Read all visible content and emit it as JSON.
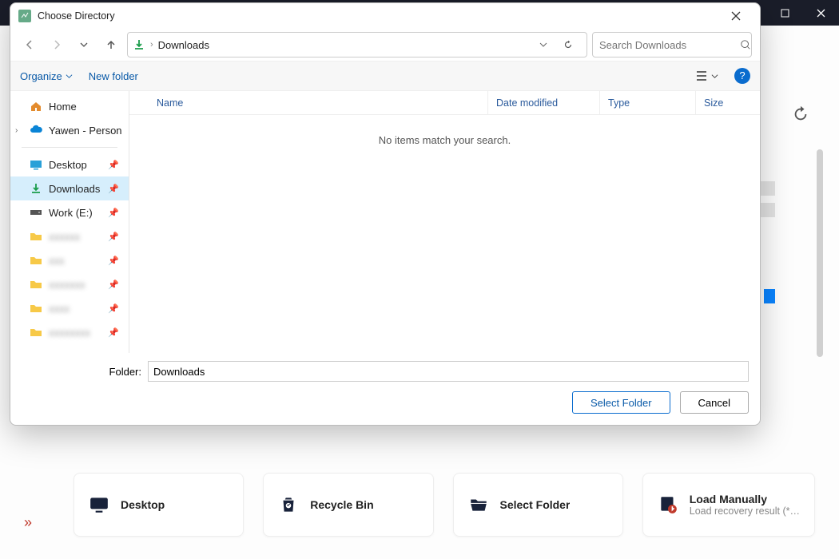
{
  "dialog": {
    "title": "Choose Directory",
    "breadcrumb": "Downloads",
    "search_placeholder": "Search Downloads",
    "toolbar": {
      "organize": "Organize",
      "new_folder": "New folder"
    },
    "columns": {
      "name": "Name",
      "date": "Date modified",
      "type": "Type",
      "size": "Size"
    },
    "no_items": "No items match your search.",
    "folder_label": "Folder:",
    "folder_value": "Downloads",
    "select_btn": "Select Folder",
    "cancel_btn": "Cancel"
  },
  "sidebar": {
    "home": "Home",
    "onedrive": "Yawen - Personal",
    "desktop": "Desktop",
    "downloads": "Downloads",
    "work": "Work (E:)"
  },
  "bg_cards": {
    "desktop": "Desktop",
    "recycle": "Recycle Bin",
    "select": "Select Folder",
    "load_t": "Load Manually",
    "load_s": "Load recovery result (*…"
  }
}
